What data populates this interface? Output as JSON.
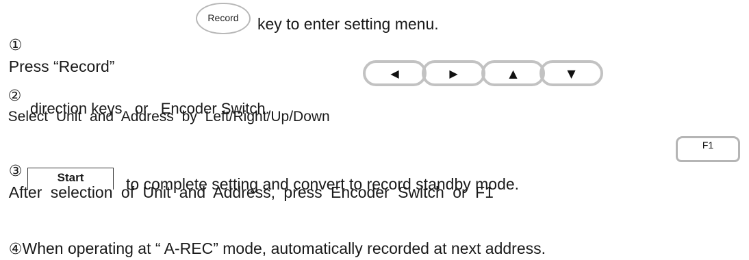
{
  "step1": {
    "num": "①",
    "text_before": "Press “Record”",
    "key_label": "Record",
    "text_after": "key to enter setting menu."
  },
  "step2": {
    "num": "②",
    "text_line1": "Select Unit and Address by Left/Right/Up/Down",
    "text_line2": "direction keys   or   Encoder Switch.",
    "keys": {
      "left": "◀",
      "right": "▶",
      "up": "▲",
      "down": "▼"
    }
  },
  "step3": {
    "num": "③",
    "text_line1": "After selection of Unit and Address, press Encoder Switch or F1",
    "f1_label": "F1",
    "start_label": "Start",
    "text_line2": "to complete setting and convert to record standby mode."
  },
  "step4": {
    "num": "④",
    "text": "When operating at “ A-REC” mode, automatically recorded at next address."
  }
}
